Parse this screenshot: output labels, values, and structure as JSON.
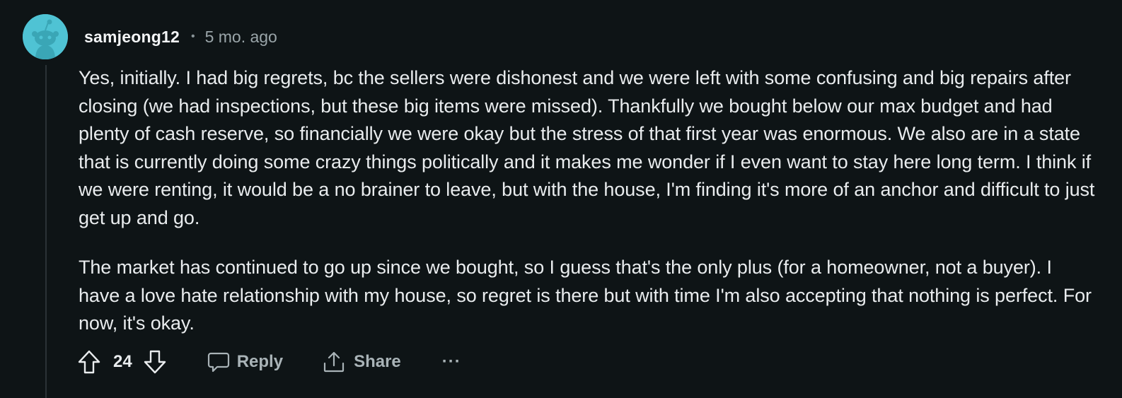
{
  "comment": {
    "username": "samjeong12",
    "separator": "•",
    "time_ago": "5 mo. ago",
    "avatar_icon": "reddit-snoo-avatar-icon",
    "avatar_color": "#4fc3d4",
    "paragraphs": [
      "Yes, initially. I had big regrets, bc the sellers were dishonest and we were left with some confusing and big repairs after closing (we had inspections, but these big items were missed). Thankfully we bought below our max budget and had plenty of cash reserve, so financially we were okay but the stress of that first year was enormous. We also are in a state that is currently doing some crazy things politically and it makes me wonder if I even want to stay here long term. I think if we were renting, it would be a no brainer to leave, but with the house, I'm finding it's more of an anchor and difficult to just get up and go.",
      "The market has continued to go up since we bought, so I guess that's the only plus (for a homeowner, not a buyer). I have a love hate relationship with my house, so regret is there but with time I'm also accepting that nothing is perfect. For now, it's okay."
    ]
  },
  "actions": {
    "upvote_icon": "upvote-arrow-icon",
    "score": "24",
    "downvote_icon": "downvote-arrow-icon",
    "reply_icon": "speech-bubble-icon",
    "reply_label": "Reply",
    "share_icon": "share-upload-icon",
    "share_label": "Share",
    "more_label": "···"
  }
}
